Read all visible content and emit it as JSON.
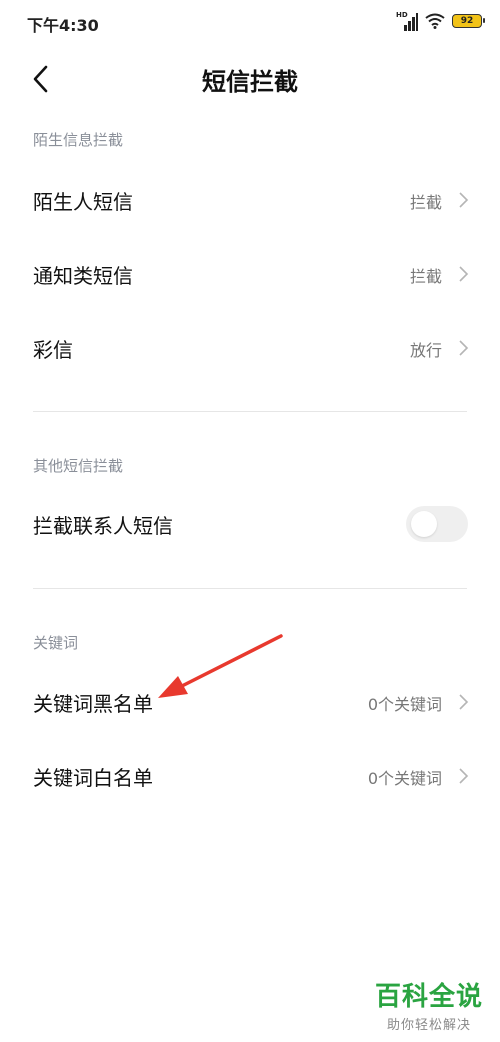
{
  "status": {
    "time": "下午4:30",
    "network": "HD",
    "battery": "92"
  },
  "header": {
    "title": "短信拦截"
  },
  "sections": [
    {
      "header": "陌生信息拦截",
      "items": [
        {
          "label": "陌生人短信",
          "value": "拦截"
        },
        {
          "label": "通知类短信",
          "value": "拦截"
        },
        {
          "label": "彩信",
          "value": "放行"
        }
      ]
    },
    {
      "header": "其他短信拦截",
      "items": [
        {
          "label": "拦截联系人短信",
          "toggle": false
        }
      ]
    },
    {
      "header": "关键词",
      "items": [
        {
          "label": "关键词黑名单",
          "value": "0个关键词"
        },
        {
          "label": "关键词白名单",
          "value": "0个关键词"
        }
      ]
    }
  ],
  "annotation": {
    "arrow_color": "#e8392e"
  },
  "watermark": {
    "title": "百科全说",
    "subtitle": "助你轻松解决",
    "color": "#2aa441"
  }
}
